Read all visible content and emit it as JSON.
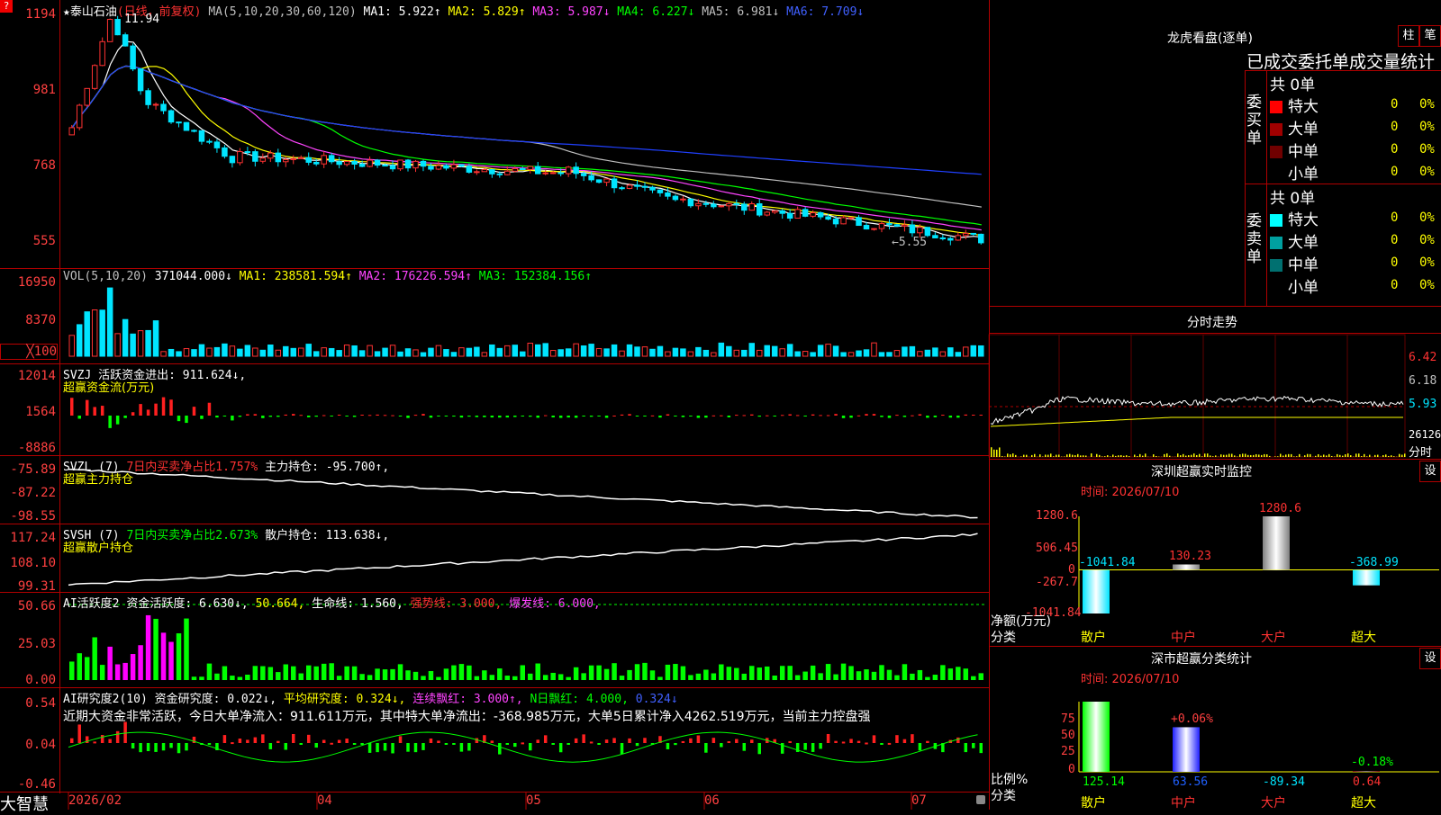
{
  "stock": {
    "star_name": "★泰山石油",
    "period": "(日线，前复权)"
  },
  "ma_header": {
    "label": "MA(5,10,20,30,60,120)",
    "ma1": "MA1: 5.922↑",
    "ma2": "MA2: 5.829↑",
    "ma3": "MA3: 5.987↓",
    "ma4": "MA4: 6.227↓",
    "ma5": "MA5: 6.981↓",
    "ma6": "MA6: 7.709↓"
  },
  "price_axis": [
    "1194",
    "981",
    "768",
    "555"
  ],
  "price_annotations": {
    "high": "11.94",
    "low": "←5.55"
  },
  "vol_header": {
    "label": "VOL(5,10,20)",
    "value": "371044.000↓",
    "ma1": "MA1: 238581.594↑",
    "ma2": "MA2: 176226.594↑",
    "ma3": "MA3: 152384.156↑"
  },
  "vol_axis": [
    "16950",
    "8370",
    "╳100"
  ],
  "svzj_header": {
    "label": "SVZJ  活跃资金进出: 911.624↓,",
    "sub": "超赢资金流(万元)"
  },
  "svzj_axis": [
    "12014",
    "1564",
    "-8886"
  ],
  "svzl_header": {
    "label": "SVZL (7)",
    "pct": "7日内买卖净占比1.757%",
    "hold": "主力持仓: -95.700↑,",
    "sub": "超赢主力持仓"
  },
  "svzl_axis": [
    "-75.89",
    "-87.22",
    "-98.55"
  ],
  "svsh_header": {
    "label": "SVSH (7)",
    "pct": "7日内买卖净占比2.673%",
    "hold": "散户持仓: 113.638↓,",
    "sub": "超赢散户持仓"
  },
  "svsh_axis": [
    "117.24",
    "108.10",
    "99.31"
  ],
  "ai1_header": {
    "label": "AI活跃度2",
    "a": "资金活跃度: 6.630↓,",
    "b": "50.664,",
    "c": "生命线: 1.560,",
    "d": "强势线: 3.000,",
    "e": "爆发线: 6.000,"
  },
  "ai1_axis": [
    "50.66",
    "25.03",
    "0.00"
  ],
  "ai2_header": {
    "label": "AI研究度2(10)",
    "a": "资金研究度: 0.022↓,",
    "b": "平均研究度: 0.324↓,",
    "c": "连续飘红: 3.000↑,",
    "d": "N日飘红: 4.000,",
    "e": "0.324↓"
  },
  "ai2_text": "近期大资金非常活跃，今日大单净流入：911.611万元，其中特大单净流出：-368.985万元，大单5日累计净入4262.519万元，当前主力控盘强",
  "ai2_axis": [
    "0.54",
    "0.04",
    "-0.46"
  ],
  "x_axis": [
    "2026/02",
    "04",
    "05",
    "06",
    "07"
  ],
  "brand": "大智慧",
  "longhu": {
    "title": "龙虎看盘(逐单)",
    "btn1": "柱",
    "btn2": "笔",
    "subtitle": "已成交委托单成交量统计",
    "buy_label": "委买单",
    "sell_label": "委卖单",
    "buy_total": "共 0单",
    "sell_total": "共 0单",
    "buy_rows": [
      {
        "name": "特大",
        "num": "0",
        "pct": "0%",
        "color": "#ff0000"
      },
      {
        "name": "大单",
        "num": "0",
        "pct": "0%",
        "color": "#a00000"
      },
      {
        "name": "中单",
        "num": "0",
        "pct": "0%",
        "color": "#700000"
      },
      {
        "name": "小单",
        "num": "0",
        "pct": "0%",
        "color": "#000000"
      }
    ],
    "sell_rows": [
      {
        "name": "特大",
        "num": "0",
        "pct": "0%",
        "color": "#00ffff"
      },
      {
        "name": "大单",
        "num": "0",
        "pct": "0%",
        "color": "#00a0a0"
      },
      {
        "name": "中单",
        "num": "0",
        "pct": "0%",
        "color": "#007070"
      },
      {
        "name": "小单",
        "num": "0",
        "pct": "0%",
        "color": "#000000"
      }
    ]
  },
  "intraday": {
    "title": "分时走势",
    "axis": [
      "6.42",
      "6.18",
      "5.93"
    ],
    "vol_label": "26126",
    "vol_unit": "分时"
  },
  "sz_monitor": {
    "title": "深圳超赢实时监控",
    "btn": "设",
    "time": "时间: 2026/07/10",
    "axis": [
      "1280.6",
      "506.45",
      "0",
      "-267.7",
      "-1041.84"
    ],
    "unit": "净额(万元)",
    "cat_label": "分类",
    "categories": [
      "散户",
      "中户",
      "大户",
      "超大"
    ],
    "values": [
      -1041.84,
      130.23,
      1280.6,
      -368.99
    ],
    "value_labels": [
      "-1041.84",
      "130.23",
      "1280.6",
      "-368.99"
    ]
  },
  "sz_class": {
    "title": "深市超赢分类统计",
    "btn": "设",
    "time": "时间: 2026/07/10",
    "axis": [
      "75",
      "50",
      "25",
      "0"
    ],
    "unit": "比例%",
    "cat_label": "分类",
    "categories": [
      "散户",
      "中户",
      "大户",
      "超大"
    ],
    "values": [
      125.14,
      63.56,
      -89.34,
      0.64
    ],
    "bar_labels": [
      "+0.06%",
      "-0.18%"
    ]
  },
  "chart_data": [
    {
      "type": "table",
      "title": "龙虎看盘(逐单)"
    },
    {
      "type": "bar",
      "title": "深圳超赢实时监控",
      "categories": [
        "散户",
        "中户",
        "大户",
        "超大"
      ],
      "values": [
        -1041.84,
        130.23,
        1280.6,
        -368.99
      ],
      "ylabel": "净额(万元)",
      "ylim": [
        -1041.84,
        1280.6
      ]
    },
    {
      "type": "bar",
      "title": "深市超赢分类统计",
      "categories": [
        "散户",
        "中户",
        "大户",
        "超大"
      ],
      "values": [
        125.14,
        63.56,
        -89.34,
        0.64
      ],
      "ylabel": "比例%",
      "ylim": [
        0,
        75
      ]
    }
  ]
}
